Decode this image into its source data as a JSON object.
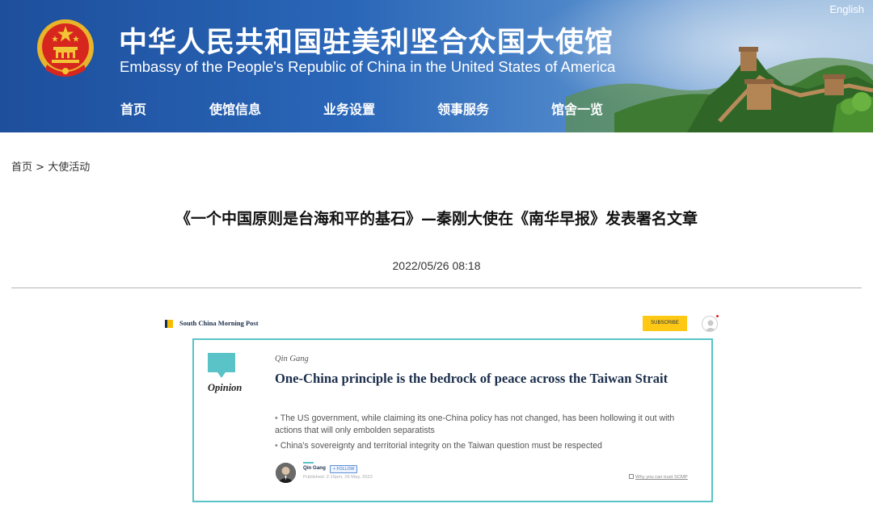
{
  "header": {
    "title_cn": "中华人民共和国驻美利坚合众国大使馆",
    "title_en": "Embassy of the People's Republic of China in the United States of America",
    "lang_link": "English"
  },
  "nav": {
    "items": [
      "首页",
      "使馆信息",
      "业务设置",
      "领事服务",
      "馆舍一览"
    ]
  },
  "breadcrumb": {
    "home": "首页",
    "separator": ">",
    "current": "大使活动"
  },
  "article": {
    "title": "《一个中国原则是台海和平的基石》—秦刚大使在《南华早报》发表署名文章",
    "date": "2022/05/26 08:18"
  },
  "scmp": {
    "logo_text": "South China Morning Post",
    "subscribe_label": "SUBSCRIBE",
    "section_label": "Opinion",
    "author": "Qin Gang",
    "headline": "One-China principle is the bedrock of peace across the Taiwan Strait",
    "bullets": [
      "The US government, while claiming its one-China policy has not changed, has been hollowing it out with actions that will only embolden separatists",
      "China's sovereignty and territorial integrity on the Taiwan question must be respected"
    ],
    "byline_name": "Qin Gang",
    "follow_label": "+ FOLLOW",
    "published": "Published: 2:15pm, 26 May, 2022",
    "trust_link": "Why you can trust SCMP"
  },
  "colors": {
    "header_blue": "#1d4f9c",
    "scmp_teal": "#59c3c8",
    "scmp_navy": "#1b2e4b",
    "scmp_yellow": "#ffc815"
  },
  "icons": [
    "national-emblem-icon",
    "great-wall-scenery",
    "scmp-logo-icon",
    "user-avatar-icon",
    "opinion-speech-bubble-icon",
    "trust-icon"
  ]
}
